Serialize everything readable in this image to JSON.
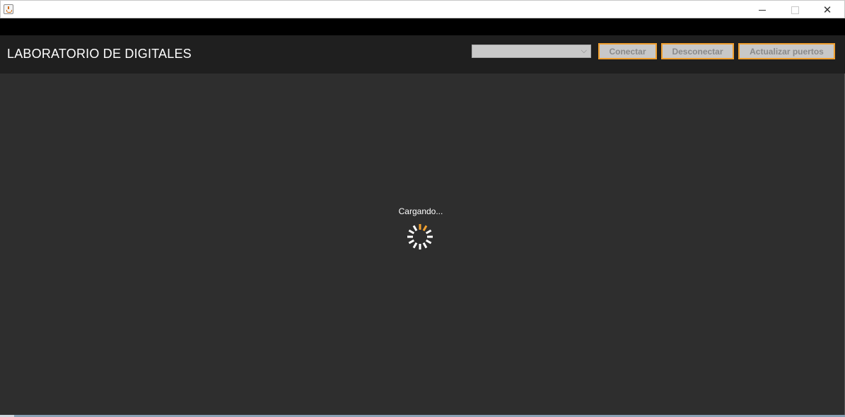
{
  "window": {
    "title": "",
    "icon": "java-cup-icon",
    "controls": [
      "minimize-icon",
      "maximize-icon",
      "close-icon"
    ],
    "close_glyph": "✕"
  },
  "header": {
    "title": "LABORATORIO DE DIGITALES",
    "port_select": {
      "selected": "",
      "icon": "chevron-down-icon",
      "glyph": "⌵"
    },
    "buttons": {
      "connect": "Conectar",
      "disconnect": "Desconectar",
      "refresh_ports": "Actualizar puertos"
    }
  },
  "main": {
    "loading_text": "Cargando...",
    "spinner": {
      "icon": "loading-spinner-icon",
      "ticks": 12,
      "active_tick": 0
    }
  },
  "colors": {
    "background": "#2e2e2e",
    "header": "#1f1f1f",
    "accent": "#f0a030",
    "spinner_active": "#f0a030",
    "spinner_inactive": "#ffffff"
  }
}
